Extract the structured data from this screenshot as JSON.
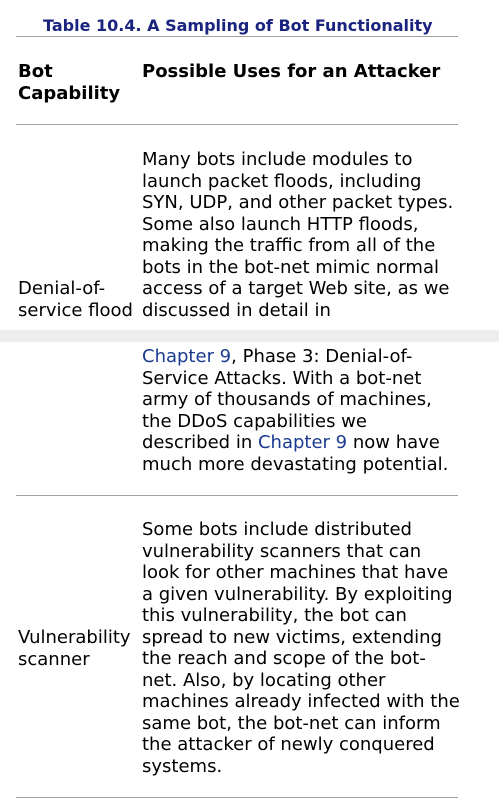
{
  "table": {
    "caption": "Table 10.4. A Sampling of Bot Functionality",
    "headers": {
      "capability": "Bot Capability",
      "uses": "Possible Uses for an Attacker"
    },
    "rows": [
      {
        "capability": "Denial-of-service flood",
        "uses_part1": "Many bots include modules to launch packet floods, including SYN, UDP, and other packet types. Some also launch HTTP floods, making the traffic from all of the bots in the bot-net mimic normal access of a target Web site, as we discussed in detail in",
        "uses_part2": {
          "link1": "Chapter 9",
          "text1": ", Phase 3: Denial-of-Service Attacks. With a bot-net army of thousands of machines, the DDoS capabilities we described in ",
          "link2": "Chapter 9",
          "text2": " now have much more devastating potential."
        }
      },
      {
        "capability": "Vulnerability scanner",
        "uses": "Some bots include distributed vulnerability scanners that can look for other machines that have a given vulnerability. By exploiting this vulnerability, the bot can spread to new victims, extending the reach and scope of the bot-net. Also, by locating other machines already infected with the same bot, the bot-net can inform the attacker of newly conquered systems."
      }
    ]
  },
  "colors": {
    "caption": "#1a237e",
    "link": "#1a3a8f",
    "rule": "#a0a0a0",
    "page_gap": "#eeeeee"
  }
}
